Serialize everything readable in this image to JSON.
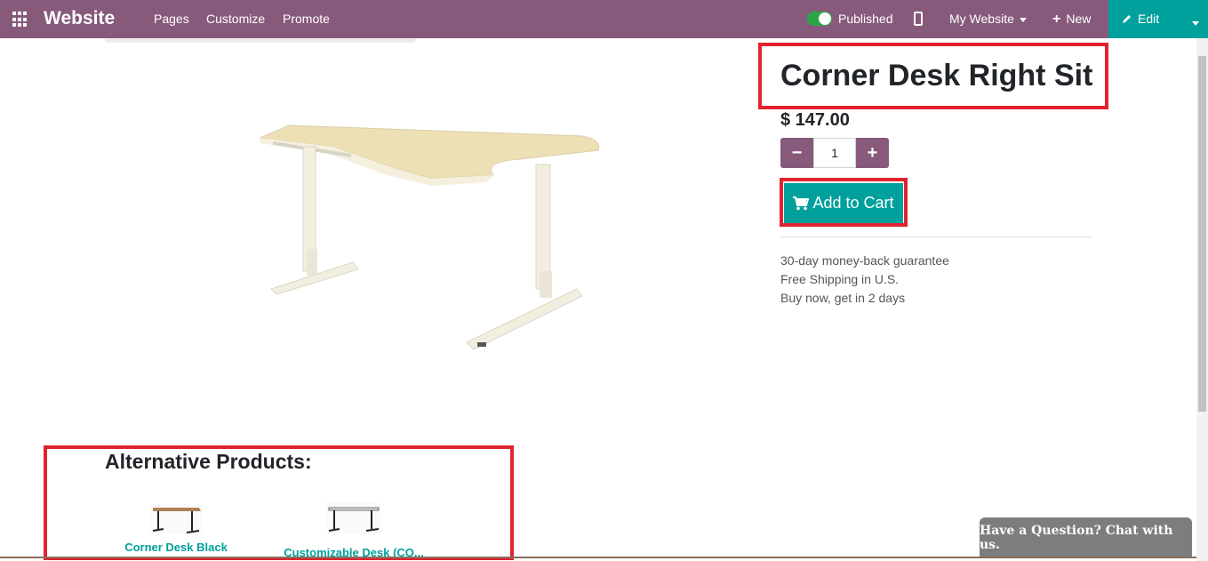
{
  "topbar": {
    "apps_icon": "grid-icon",
    "brand": "Website",
    "nav": [
      "Pages",
      "Customize",
      "Promote"
    ],
    "published_label": "Published",
    "published_on": true,
    "mobile_icon": "mobile-phone-icon",
    "site_selector": "My Website",
    "new_label": "New",
    "edit_label": "Edit",
    "colors": {
      "bar": "#875a7b",
      "edit": "#00a09d"
    }
  },
  "product": {
    "title": "Corner Desk Right Sit",
    "price": "$ 147.00",
    "quantity": "1",
    "minus_label": "−",
    "plus_label": "+",
    "add_to_cart_label": "Add to Cart",
    "cart_icon": "shopping-cart-icon",
    "info_lines": [
      "30-day money-back guarantee",
      "Free Shipping in U.S.",
      "Buy now, get in 2 days"
    ]
  },
  "alternatives": {
    "heading": "Alternative Products:",
    "items": [
      {
        "name": "Corner Desk Black"
      },
      {
        "name": "Customizable Desk (CO..."
      }
    ]
  },
  "chat": {
    "label": "Have a Question? Chat with us."
  },
  "highlight_color": "#e0232f"
}
